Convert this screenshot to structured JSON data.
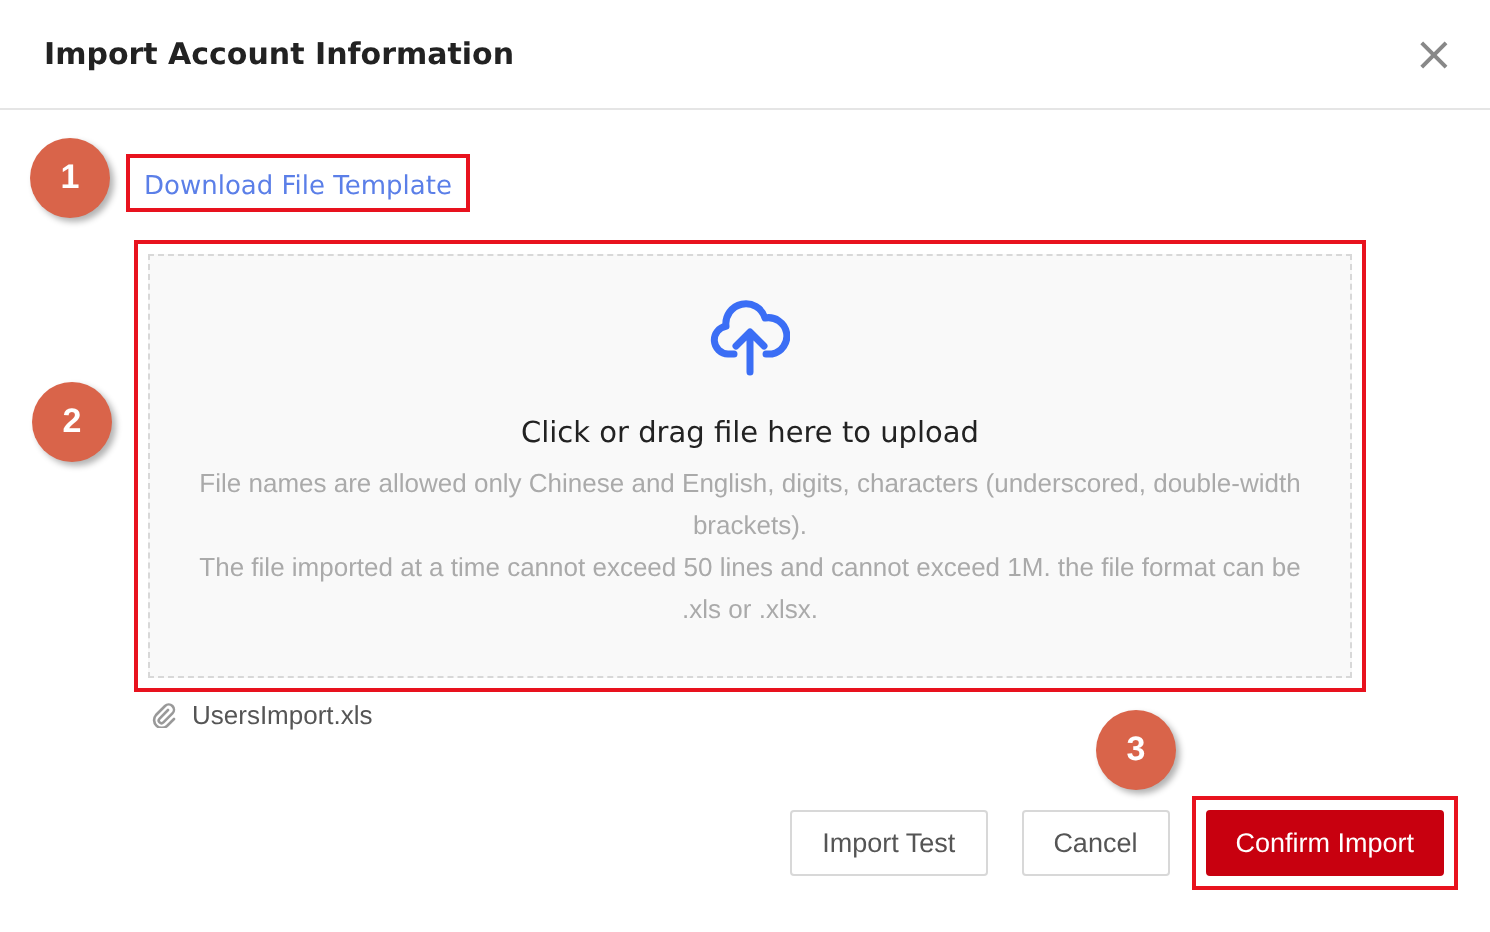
{
  "dialog": {
    "title": "Import Account Information",
    "close": "×"
  },
  "template_link": {
    "label": "Download File Template",
    "highlighted": true
  },
  "upload": {
    "title": "Click or drag file here to upload",
    "hints": [
      "File names are allowed only Chinese and English, digits, characters (underscored, double-width brackets).",
      "The file imported at a time cannot exceed 50 lines and cannot exceed 1M. the file format can be .xls or .xlsx."
    ],
    "highlighted": true
  },
  "file": {
    "name": "UsersImport.xls"
  },
  "buttons": [
    {
      "label": "Import Test",
      "kind": "default",
      "highlighted": false
    },
    {
      "label": "Cancel",
      "kind": "default",
      "highlighted": false
    },
    {
      "label": "Confirm Import",
      "kind": "primary",
      "highlighted": true
    }
  ],
  "steps": [
    "1",
    "2",
    "3"
  ]
}
